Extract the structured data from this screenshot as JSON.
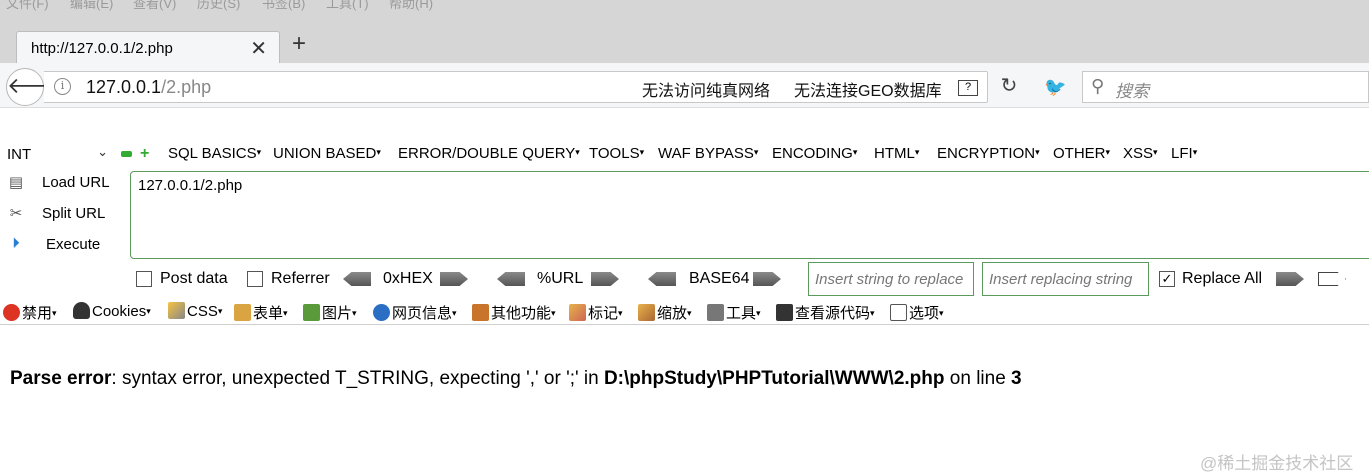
{
  "menubar": [
    "文件(F)",
    "编辑(E)",
    "查看(V)",
    "历史(S)",
    "书签(B)",
    "工具(T)",
    "帮助(H)"
  ],
  "tab": {
    "title": "http://127.0.0.1/2.php",
    "close": "✕"
  },
  "newtab": "+",
  "address": {
    "host": "127.0.0.1",
    "path": "/2.php",
    "status_a": "无法访问纯真网络",
    "status_b": "无法连接GEO数据库",
    "qicon": "?"
  },
  "search": {
    "placeholder": "搜索"
  },
  "hackbar": {
    "select_value": "INT",
    "menus": [
      "SQL BASICS",
      "UNION BASED",
      "ERROR/DOUBLE QUERY",
      "TOOLS",
      "WAF BYPASS",
      "ENCODING",
      "HTML",
      "ENCRYPTION",
      "OTHER",
      "XSS",
      "LFI"
    ],
    "load_url": "Load URL",
    "split_url": "Split URL",
    "execute": "Execute",
    "url_value": "127.0.0.1/2.php",
    "post_data": "Post data",
    "referrer": "Referrer",
    "hex": "0xHEX",
    "url_enc": "%URL",
    "base64": "BASE64",
    "insert_string_ph": "Insert string to replace",
    "insert_replacing_ph": "Insert replacing string",
    "replace_all": "Replace All",
    "replace_all_checked": true
  },
  "webdev": [
    "禁用",
    "Cookies",
    "CSS",
    "表单",
    "图片",
    "网页信息",
    "其他功能",
    "标记",
    "缩放",
    "工具",
    "查看源代码",
    "选项"
  ],
  "page": {
    "error_label": "Parse error",
    "error_text": ": syntax error, unexpected T_STRING, expecting ',' or ';' in ",
    "error_path": "D:\\phpStudy\\PHPTutorial\\WWW\\2.php",
    "error_on_line": " on line ",
    "error_line": "3"
  },
  "watermark": "@稀土掘金技术社区",
  "colors": {
    "accent_green": "#5a9a5a",
    "chrome_gray": "#d6d6d6"
  }
}
